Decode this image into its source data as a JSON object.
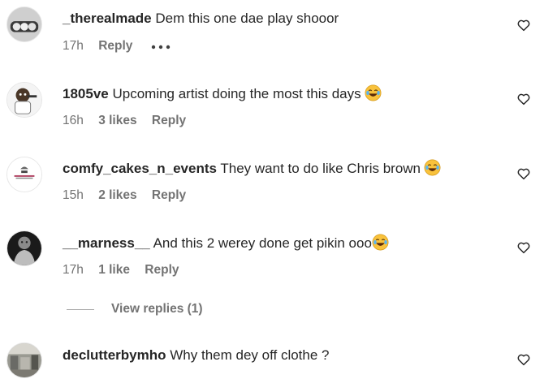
{
  "comments": [
    {
      "username": "_therealmade",
      "text": "Dem this one dae play shooor",
      "time": "17h",
      "likes": "",
      "reply": "Reply",
      "has_emoji": false,
      "avatar_icon": "avatar-grayscale-photo"
    },
    {
      "username": "1805ve",
      "text": "Upcoming artist doing the most this days",
      "time": "16h",
      "likes": "3 likes",
      "reply": "Reply",
      "has_emoji": true,
      "avatar_icon": "avatar-cartoon-character"
    },
    {
      "username": "comfy_cakes_n_events",
      "text": "They want to do like Chris brown",
      "time": "15h",
      "likes": "2 likes",
      "reply": "Reply",
      "has_emoji": true,
      "avatar_icon": "avatar-cake-logo"
    },
    {
      "username": "__marness__",
      "text": "And this 2 werey done get pikin ooo",
      "time": "17h",
      "likes": "1 like",
      "reply": "Reply",
      "has_emoji": true,
      "avatar_icon": "avatar-dark-photo"
    },
    {
      "username": "declutterbymho",
      "text": "Why them dey off clothe ?",
      "time": "",
      "likes": "",
      "reply": "",
      "has_emoji": false,
      "avatar_icon": "avatar-room-photo"
    }
  ],
  "view_replies": "View replies (1)",
  "icons": {
    "like": "heart-outline-icon",
    "more": "more-options-icon",
    "emoji": "face-with-tears-of-joy"
  },
  "colors": {
    "text": "#262626",
    "secondary": "#737373",
    "emoji_yellow": "#f9c23c"
  }
}
